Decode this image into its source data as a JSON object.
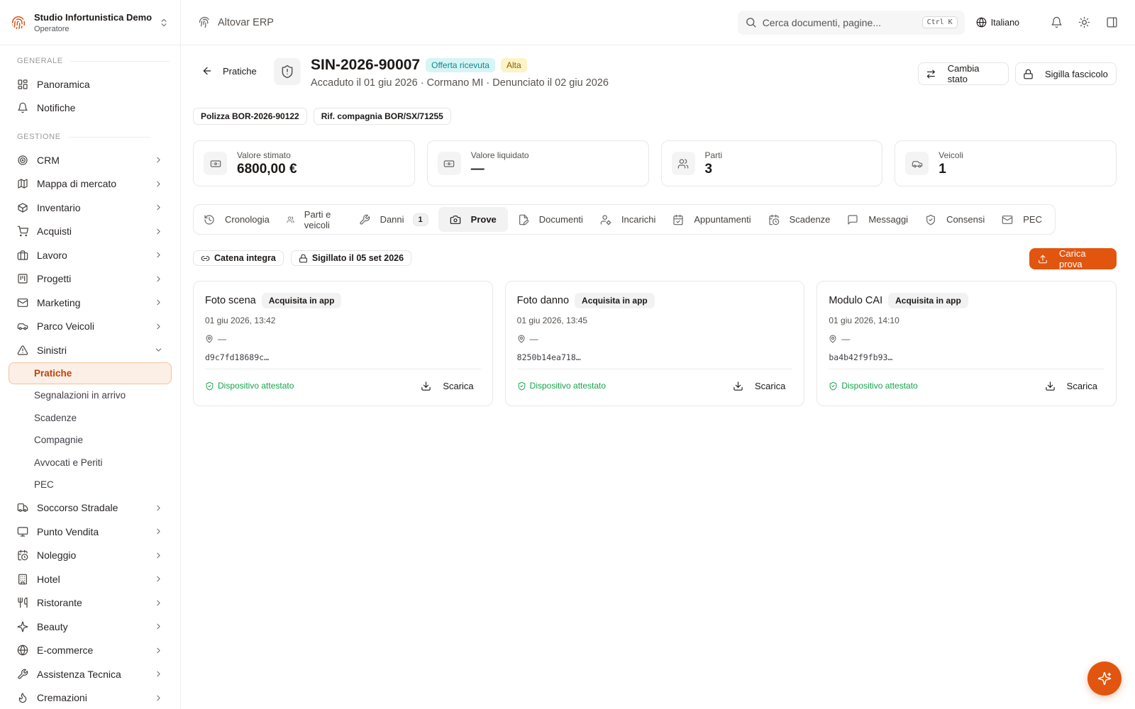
{
  "colors": {
    "accent": "#e2550f",
    "success": "#16a34a",
    "teal_badge": "#0f8a8f",
    "yellow_badge": "#8a6100"
  },
  "sidebar": {
    "org_name": "Studio Infortunistica Demo",
    "org_role": "Operatore",
    "section_general": "GENERALE",
    "general_items": [
      {
        "label": "Panoramica",
        "icon": "dashboard-icon"
      },
      {
        "label": "Notifiche",
        "icon": "bell-icon"
      }
    ],
    "section_management": "GESTIONE",
    "items": [
      {
        "label": "CRM",
        "icon": "target-icon"
      },
      {
        "label": "Mappa di mercato",
        "icon": "map-icon"
      },
      {
        "label": "Inventario",
        "icon": "box-icon"
      },
      {
        "label": "Acquisti",
        "icon": "cart-icon"
      },
      {
        "label": "Lavoro",
        "icon": "briefcase-icon"
      },
      {
        "label": "Progetti",
        "icon": "project-icon"
      },
      {
        "label": "Marketing",
        "icon": "mail-icon"
      },
      {
        "label": "Parco Veicoli",
        "icon": "car-icon"
      },
      {
        "label": "Sinistri",
        "icon": "alert-triangle-icon"
      }
    ],
    "sinistri_sub": [
      {
        "label": "Pratiche"
      },
      {
        "label": "Segnalazioni in arrivo"
      },
      {
        "label": "Scadenze"
      },
      {
        "label": "Compagnie"
      },
      {
        "label": "Avvocati e Periti"
      },
      {
        "label": "PEC"
      }
    ],
    "items_after": [
      {
        "label": "Soccorso Stradale",
        "icon": "truck-icon"
      },
      {
        "label": "Punto Vendita",
        "icon": "monitor-icon"
      },
      {
        "label": "Noleggio",
        "icon": "calendar-clock-icon"
      },
      {
        "label": "Hotel",
        "icon": "building-icon"
      },
      {
        "label": "Ristorante",
        "icon": "utensils-icon"
      },
      {
        "label": "Beauty",
        "icon": "sparkles-icon"
      },
      {
        "label": "E-commerce",
        "icon": "globe-icon"
      },
      {
        "label": "Assistenza Tecnica",
        "icon": "wrench-icon"
      },
      {
        "label": "Cremazioni",
        "icon": "flame-icon"
      }
    ]
  },
  "topbar": {
    "app_title": "Altovar ERP",
    "search_placeholder": "Cerca documenti, pagine...",
    "search_shortcut": "Ctrl K",
    "language": "Italiano"
  },
  "header": {
    "back_label": "Pratiche",
    "case_id": "SIN-2026-90007",
    "status_badge": "Offerta ricevuta",
    "priority_badge": "Alta",
    "subtitle": "Accaduto il 01 giu 2026 · Cormano MI · Denunciato il 02 giu 2026",
    "change_status_label": "Cambia stato",
    "seal_label": "Sigilla fascicolo",
    "policy_pill": "Polizza BOR-2026-90122",
    "company_ref_pill": "Rif. compagnia BOR/SX/71255"
  },
  "stats": [
    {
      "label": "Valore stimato",
      "value": "6800,00 €",
      "icon": "banknote-icon"
    },
    {
      "label": "Valore liquidato",
      "value": "—",
      "icon": "banknote-icon"
    },
    {
      "label": "Parti",
      "value": "3",
      "icon": "users-icon"
    },
    {
      "label": "Veicoli",
      "value": "1",
      "icon": "car-icon"
    }
  ],
  "tabs": [
    {
      "label": "Cronologia",
      "icon": "history-icon"
    },
    {
      "label": "Parti e veicoli",
      "icon": "users-icon"
    },
    {
      "label": "Danni",
      "icon": "wrench-icon",
      "count": "1"
    },
    {
      "label": "Prove",
      "icon": "camera-icon",
      "active": true
    },
    {
      "label": "Documenti",
      "icon": "file-edit-icon"
    },
    {
      "label": "Incarichi",
      "icon": "user-cog-icon"
    },
    {
      "label": "Appuntamenti",
      "icon": "calendar-check-icon"
    },
    {
      "label": "Scadenze",
      "icon": "calendar-clock-icon"
    },
    {
      "label": "Messaggi",
      "icon": "message-icon"
    },
    {
      "label": "Consensi",
      "icon": "shield-check-icon"
    },
    {
      "label": "PEC",
      "icon": "mail-icon"
    }
  ],
  "evidence": {
    "chain_label": "Catena integra",
    "sealed_label": "Sigillato il 05 set 2026",
    "upload_label": "Carica prova",
    "cards": [
      {
        "title": "Foto scena",
        "badge": "Acquisita in app",
        "date": "01 giu 2026, 13:42",
        "location": "—",
        "hash": "d9c7fd18689c…",
        "attest": "Dispositivo attestato",
        "download": "Scarica"
      },
      {
        "title": "Foto danno",
        "badge": "Acquisita in app",
        "date": "01 giu 2026, 13:45",
        "location": "—",
        "hash": "8250b14ea718…",
        "attest": "Dispositivo attestato",
        "download": "Scarica"
      },
      {
        "title": "Modulo CAI",
        "badge": "Acquisita in app",
        "date": "01 giu 2026, 14:10",
        "location": "—",
        "hash": "ba4b42f9fb93…",
        "attest": "Dispositivo attestato",
        "download": "Scarica"
      }
    ]
  }
}
